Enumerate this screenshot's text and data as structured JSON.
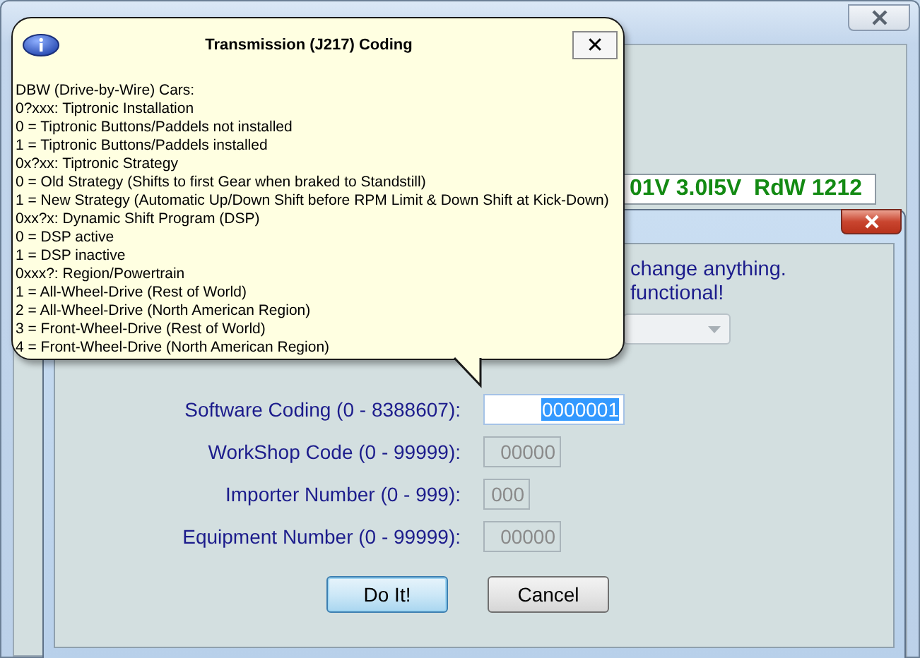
{
  "main_window": {
    "readout": "01V 3.0I5V  RdW 1212"
  },
  "dialog": {
    "warning_lines": [
      "change anything.",
      "functional!"
    ],
    "dropdown": {
      "disabled": true
    },
    "fields": [
      {
        "label": "Software Coding (0 - 8388607):",
        "value": "0000001",
        "disabled": false,
        "text_selected": true
      },
      {
        "label": "WorkShop Code (0 - 99999):",
        "value": "00000",
        "disabled": true,
        "text_selected": false
      },
      {
        "label": "Importer Number (0 - 999):",
        "value": "000",
        "disabled": true,
        "text_selected": false
      },
      {
        "label": "Equipment Number (0 - 99999):",
        "value": "00000",
        "disabled": true,
        "text_selected": false
      }
    ],
    "buttons": [
      {
        "label": "Do It!",
        "default": true
      },
      {
        "label": "Cancel",
        "default": false
      }
    ]
  },
  "balloon": {
    "title": "Transmission (J217) Coding",
    "close_label": "✕",
    "lines": [
      "DBW (Drive-by-Wire) Cars:",
      "0?xxx: Tiptronic Installation",
      "0 = Tiptronic Buttons/Paddels not installed",
      "1 = Tiptronic Buttons/Paddels installed",
      "0x?xx: Tiptronic Strategy",
      "0 = Old Strategy (Shifts to first Gear when braked to Standstill)",
      "1 = New Strategy (Automatic Up/Down Shift before RPM Limit & Down Shift at Kick-Down)",
      "0xx?x: Dynamic Shift Program (DSP)",
      "0 = DSP active",
      "1 = DSP inactive",
      "0xxx?: Region/Powertrain",
      "1 = All-Wheel-Drive (Rest of World)",
      "2 = All-Wheel-Drive (North American Region)",
      "3 = Front-Wheel-Drive (Rest of World)",
      "4 = Front-Wheel-Drive (North American Region)"
    ]
  }
}
